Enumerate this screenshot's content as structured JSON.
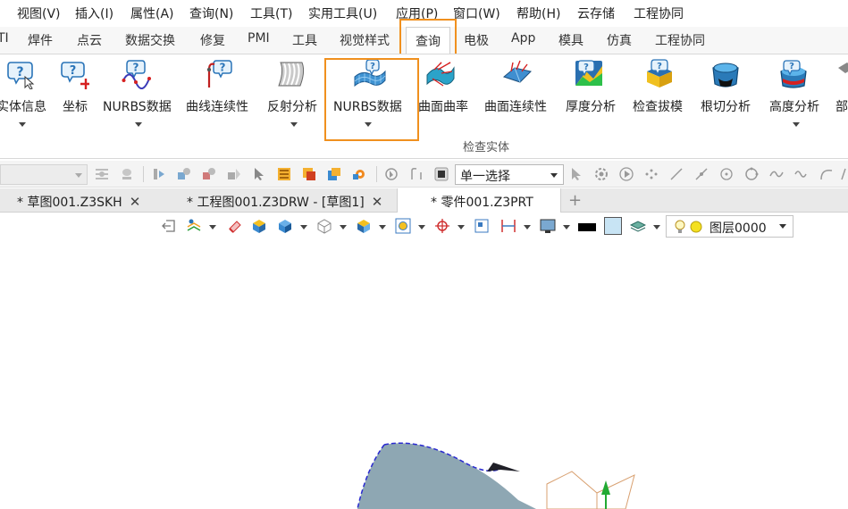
{
  "menu": {
    "items": [
      "视图(V)",
      "插入(I)",
      "属性(A)",
      "查询(N)",
      "工具(T)",
      "实用工具(U)",
      "应用(P)",
      "窗口(W)",
      "帮助(H)",
      "云存储",
      "工程协同"
    ]
  },
  "ribbon_tabs": {
    "items": [
      "TI",
      "焊件",
      "点云",
      "数据交换",
      "修复",
      "PMI",
      "工具",
      "视觉样式",
      "查询",
      "电极",
      "App",
      "模具",
      "仿真",
      "工程协同"
    ],
    "active": "查询"
  },
  "ribbon": {
    "buttons": [
      "实体信息",
      "坐标",
      "NURBS数据",
      "曲线连续性",
      "反射分析",
      "NURBS数据",
      "曲面曲率",
      "曲面连续性",
      "厚度分析",
      "检查拔模",
      "根切分析",
      "高度分析",
      "部"
    ],
    "group_label": "检查实体"
  },
  "toolbar": {
    "select_value": "单一选择"
  },
  "doc_tabs": {
    "items": [
      "* 草图001.Z3SKH",
      "* 工程图001.Z3DRW - [草图1]",
      "* 零件001.Z3PRT"
    ],
    "close_glyph": "✕",
    "add_glyph": "+",
    "active_index": 2
  },
  "view_toolbar": {
    "layer_value": "图层0000"
  },
  "colors": {
    "highlight": "#f0901e",
    "surface": "#8ea7b3",
    "axis_green": "#22aa33"
  }
}
